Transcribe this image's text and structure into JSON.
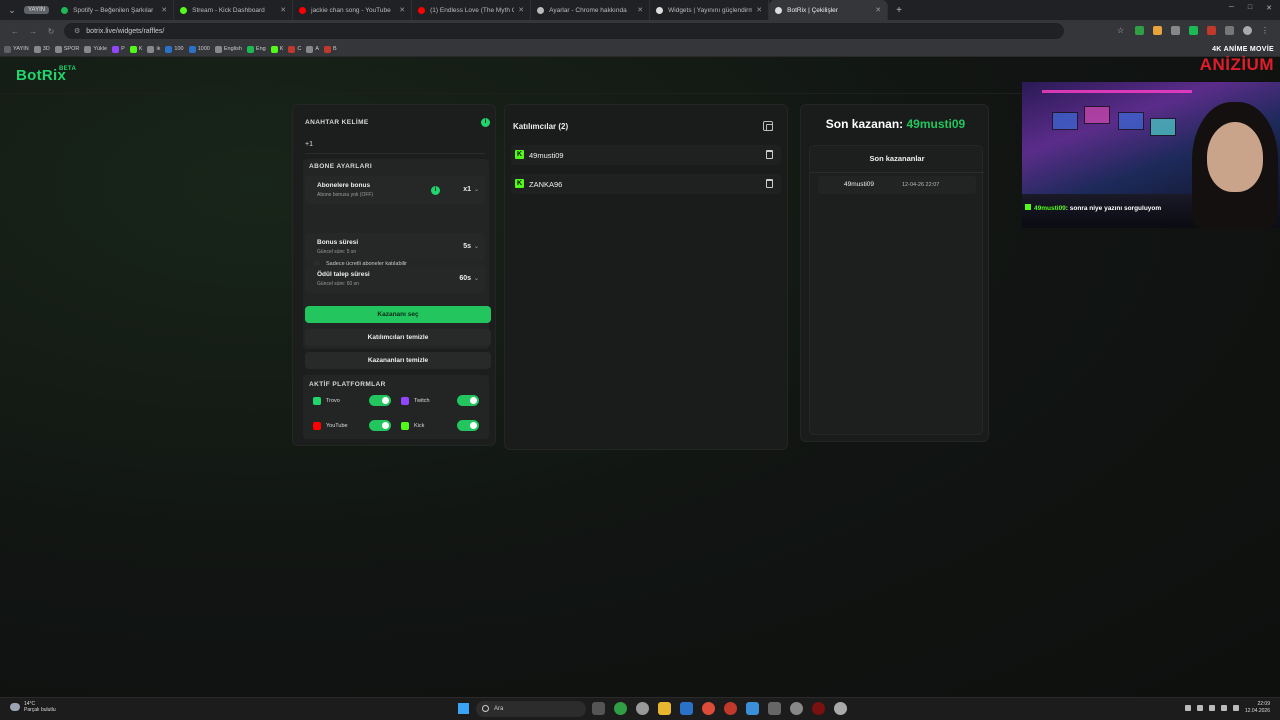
{
  "browser": {
    "profile_badge": "YAYIN",
    "tabs": [
      {
        "label": "Spotify – Beğenilen Şarkılar",
        "color": "#1db954",
        "active": false
      },
      {
        "label": "Stream - Kick Dashboard",
        "color": "#53fc18",
        "active": false
      },
      {
        "label": "jackie chan song - YouTube",
        "color": "#ff0000",
        "active": false
      },
      {
        "label": "(1) Endless Love (The Myth OS)",
        "color": "#ff0000",
        "active": false
      },
      {
        "label": "Ayarlar - Chrome hakkında",
        "color": "#bbbbbb",
        "active": false
      },
      {
        "label": "Widgets | Yayınını güçlendirmek",
        "color": "#dddddd",
        "active": false
      },
      {
        "label": "BotRix | Çekilişler",
        "color": "#dddddd",
        "active": true
      }
    ],
    "url": "botrix.live/widgets/raffles/",
    "bookmarks": [
      "YAYIN",
      "3D",
      "SPOR",
      "Yükle",
      "P",
      "K",
      "ik",
      "100",
      "1000",
      "English",
      "Eng",
      "K",
      "C",
      "A",
      "B"
    ]
  },
  "app": {
    "logo": "BotRix",
    "logo_badge": "BETA"
  },
  "settings": {
    "keyword_title": "ANAHTAR KELİME",
    "keyword_value": "+1",
    "sub_settings_title": "ABONE AYARLARI",
    "sub_bonus_title": "Abonelere bonus",
    "sub_bonus_sub": "Abone bonusu yok (OFF)",
    "sub_bonus_value": "x1",
    "only_paid_label": "Sadece ücretli aboneler katılabilir",
    "bonus_time_title": "Bonus süresi",
    "bonus_time_sub": "Güncel süre: 5 sn",
    "bonus_time_value": "5s",
    "claim_time_title": "Ödül talep süresi",
    "claim_time_sub": "Güncel süre: 60 sn",
    "claim_time_value": "60s",
    "pick_winner": "Kazananı seç",
    "clear_participants": "Katılımcıları temizle",
    "clear_winners": "Kazananları temizle",
    "platforms_title": "AKTİF PLATFORMLAR",
    "platforms": [
      {
        "name": "Trovo",
        "color": "#1fd66d",
        "enabled": true
      },
      {
        "name": "Twitch",
        "color": "#9146ff",
        "enabled": true
      },
      {
        "name": "YouTube",
        "color": "#ff0000",
        "enabled": true
      },
      {
        "name": "Kick",
        "color": "#53fc18",
        "enabled": true
      }
    ]
  },
  "participants": {
    "title": "Katılımcılar (2)",
    "items": [
      {
        "name": "49musti09",
        "platform": "kick"
      },
      {
        "name": "ZANKA96",
        "platform": "kick"
      }
    ]
  },
  "winners": {
    "last_winner_label": "Son kazanan:",
    "last_winner_name": "49musti09",
    "recent_title": "Son kazananlar",
    "items": [
      {
        "name": "49musti09",
        "date": "12-04-26 22:07"
      }
    ]
  },
  "overlay": {
    "brand_top": "4K ANİME MOVİE",
    "brand_main": "ANİZİUM",
    "chat_user": "49musti09",
    "chat_message": ": sonra niye yazını sorguluyom"
  },
  "taskbar": {
    "temperature": "14°C",
    "weather": "Parçalı bulutlu",
    "search_placeholder": "Ara",
    "time": "22:09",
    "date": "12.04.2026"
  },
  "colors": {
    "accent": "#22c55e",
    "kick": "#53fc18",
    "background": "#121412"
  }
}
